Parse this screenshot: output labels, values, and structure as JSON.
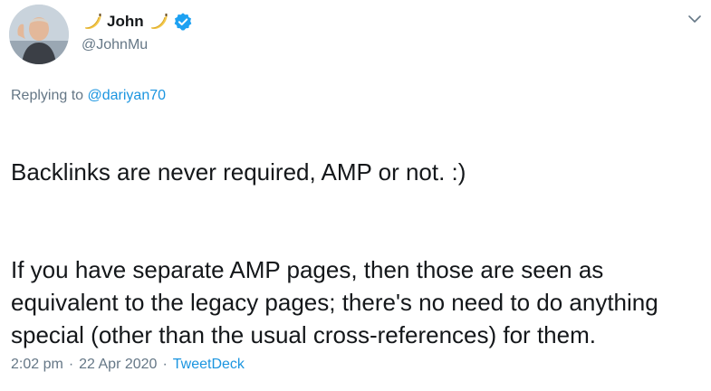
{
  "author": {
    "display_name": "John",
    "handle": "@JohnMu",
    "verified": true,
    "avatar_icon": "person-photo-avatar",
    "name_emoji": "banana-icon"
  },
  "menu_icon": "chevron-down-icon",
  "reply": {
    "prefix": "Replying to ",
    "mention": "@dariyan70"
  },
  "tweet": {
    "paragraphs": [
      "Backlinks are never required, AMP or not. :)",
      "If you have separate AMP pages, then those are seen as equivalent to the legacy pages; there's no need to do anything special (other than the usual cross-references) for them."
    ]
  },
  "meta": {
    "time": "2:02 pm",
    "separator": "·",
    "date": "22 Apr 2020",
    "source": "TweetDeck"
  },
  "colors": {
    "text": "#14171a",
    "secondary": "#657786",
    "link": "#1b95e0",
    "verified": "#1da1f2"
  }
}
